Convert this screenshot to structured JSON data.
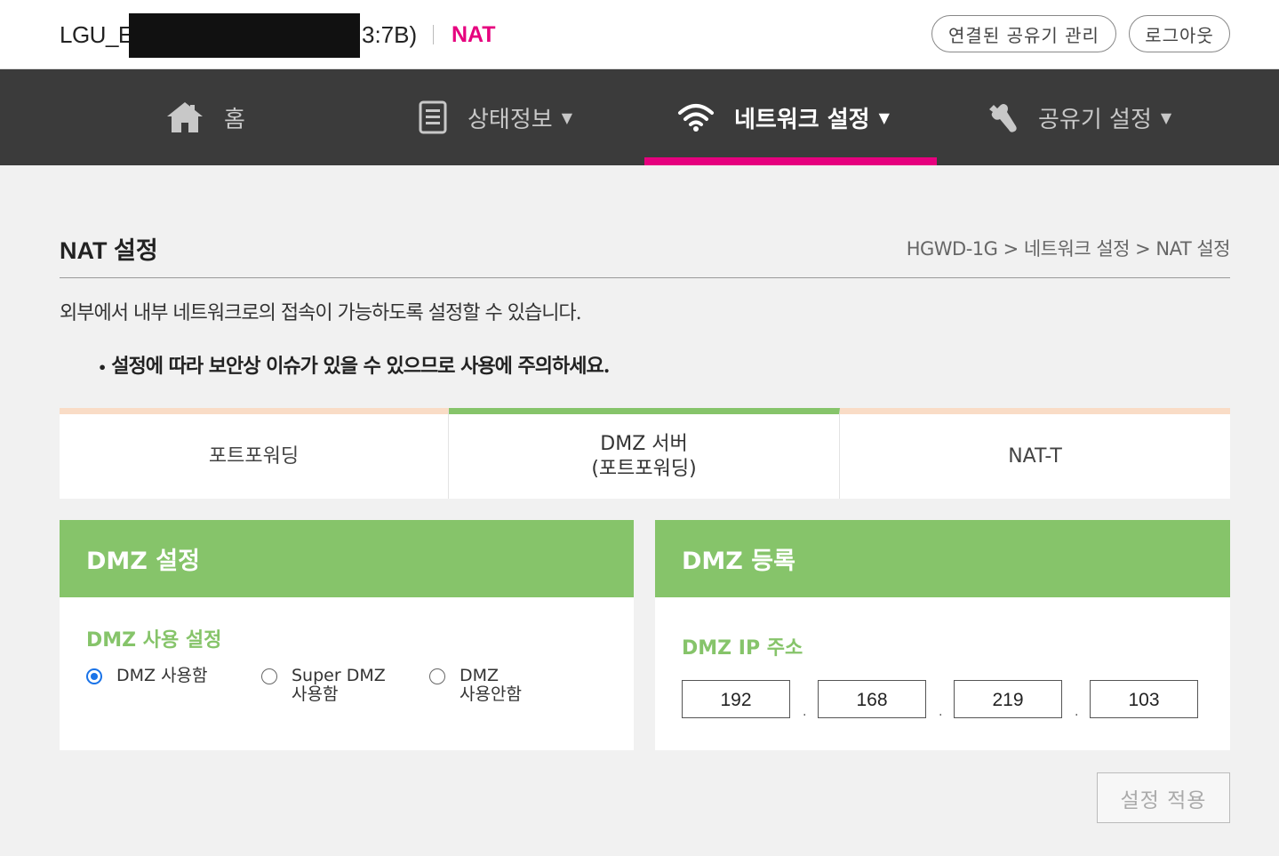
{
  "header": {
    "device_name_prefix": "LGU_E",
    "device_name_suffix": "3:7B)",
    "page_tag": "NAT",
    "connected_devices_label": "연결된 공유기 관리",
    "logout_label": "로그아웃"
  },
  "nav": {
    "items": [
      {
        "label": "홈",
        "icon": "home-icon",
        "has_caret": false
      },
      {
        "label": "상태정보",
        "icon": "document-icon",
        "has_caret": true
      },
      {
        "label": "네트워크 설정",
        "icon": "wifi-icon",
        "has_caret": true,
        "active": true
      },
      {
        "label": "공유기 설정",
        "icon": "wrench-icon",
        "has_caret": true
      }
    ],
    "caret": "▼"
  },
  "page": {
    "title": "NAT 설정",
    "breadcrumb": "HGWD-1G > 네트워크 설정 > NAT 설정",
    "description": "외부에서 내부 네트워크로의 접속이 가능하도록 설정할 수 있습니다.",
    "warning": "설정에 따라 보안상 이슈가 있을 수 있으므로 사용에 주의하세요."
  },
  "tabs": [
    {
      "label": "포트포워딩",
      "active": false
    },
    {
      "label": "DMZ 서버\n(포트포워딩)",
      "active": true
    },
    {
      "label": "NAT-T",
      "active": false
    }
  ],
  "dmz_settings": {
    "title": "DMZ 설정",
    "subtitle": "DMZ 사용 설정",
    "options": [
      {
        "label": "DMZ 사용함",
        "checked": true
      },
      {
        "label": "Super DMZ\n사용함",
        "checked": false
      },
      {
        "label": "DMZ\n사용안함",
        "checked": false
      }
    ]
  },
  "dmz_register": {
    "title": "DMZ 등록",
    "subtitle": "DMZ IP 주소",
    "ip_octets": [
      "192",
      "168",
      "219",
      "103"
    ],
    "separator": "."
  },
  "apply_label": "설정 적용",
  "colors": {
    "accent_pink": "#e6007e",
    "green": "#86c46a",
    "nav_bg": "#3b3b3b",
    "tab_inactive_top": "#f9dcc6"
  }
}
